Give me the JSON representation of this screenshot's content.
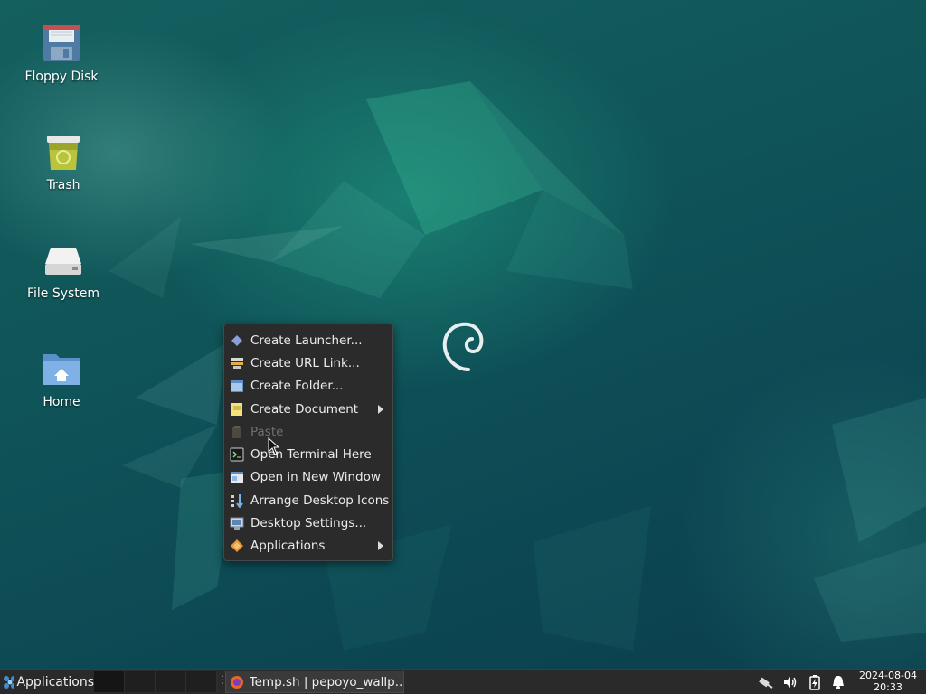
{
  "desktop": {
    "icons": [
      {
        "label": "Floppy Disk",
        "icon": "floppy-disk-icon"
      },
      {
        "label": "Trash",
        "icon": "trash-icon"
      },
      {
        "label": "File System",
        "icon": "hard-drive-icon"
      },
      {
        "label": "Home",
        "icon": "home-folder-icon"
      }
    ]
  },
  "context_menu": {
    "items": [
      {
        "label": "Create Launcher...",
        "icon": "launcher-icon",
        "enabled": true,
        "submenu": false
      },
      {
        "label": "Create URL Link...",
        "icon": "url-link-icon",
        "enabled": true,
        "submenu": false
      },
      {
        "label": "Create Folder...",
        "icon": "folder-icon",
        "enabled": true,
        "submenu": false
      },
      {
        "label": "Create Document",
        "icon": "document-icon",
        "enabled": true,
        "submenu": true
      },
      {
        "label": "Paste",
        "icon": "paste-icon",
        "enabled": false,
        "submenu": false
      },
      {
        "label": "Open Terminal Here",
        "icon": "terminal-icon",
        "enabled": true,
        "submenu": false
      },
      {
        "label": "Open in New Window",
        "icon": "new-window-icon",
        "enabled": true,
        "submenu": false
      },
      {
        "label": "Arrange Desktop Icons",
        "icon": "arrange-icon",
        "enabled": true,
        "submenu": false
      },
      {
        "label": "Desktop Settings...",
        "icon": "desktop-settings-icon",
        "enabled": true,
        "submenu": false
      },
      {
        "label": "Applications",
        "icon": "applications-icon",
        "enabled": true,
        "submenu": true
      }
    ]
  },
  "taskbar": {
    "applications_label": "Applications",
    "task_title": "Temp.sh | pepoyo_wallp...",
    "tray": [
      "network-icon",
      "volume-icon",
      "battery-icon",
      "notifications-icon"
    ],
    "clock": {
      "date": "2024-08-04",
      "time": "20:33"
    }
  },
  "colors": {
    "menu_bg": "#2b2b2b",
    "panel_bg": "#2a2a2a",
    "desktop_accent": "#14605f"
  }
}
